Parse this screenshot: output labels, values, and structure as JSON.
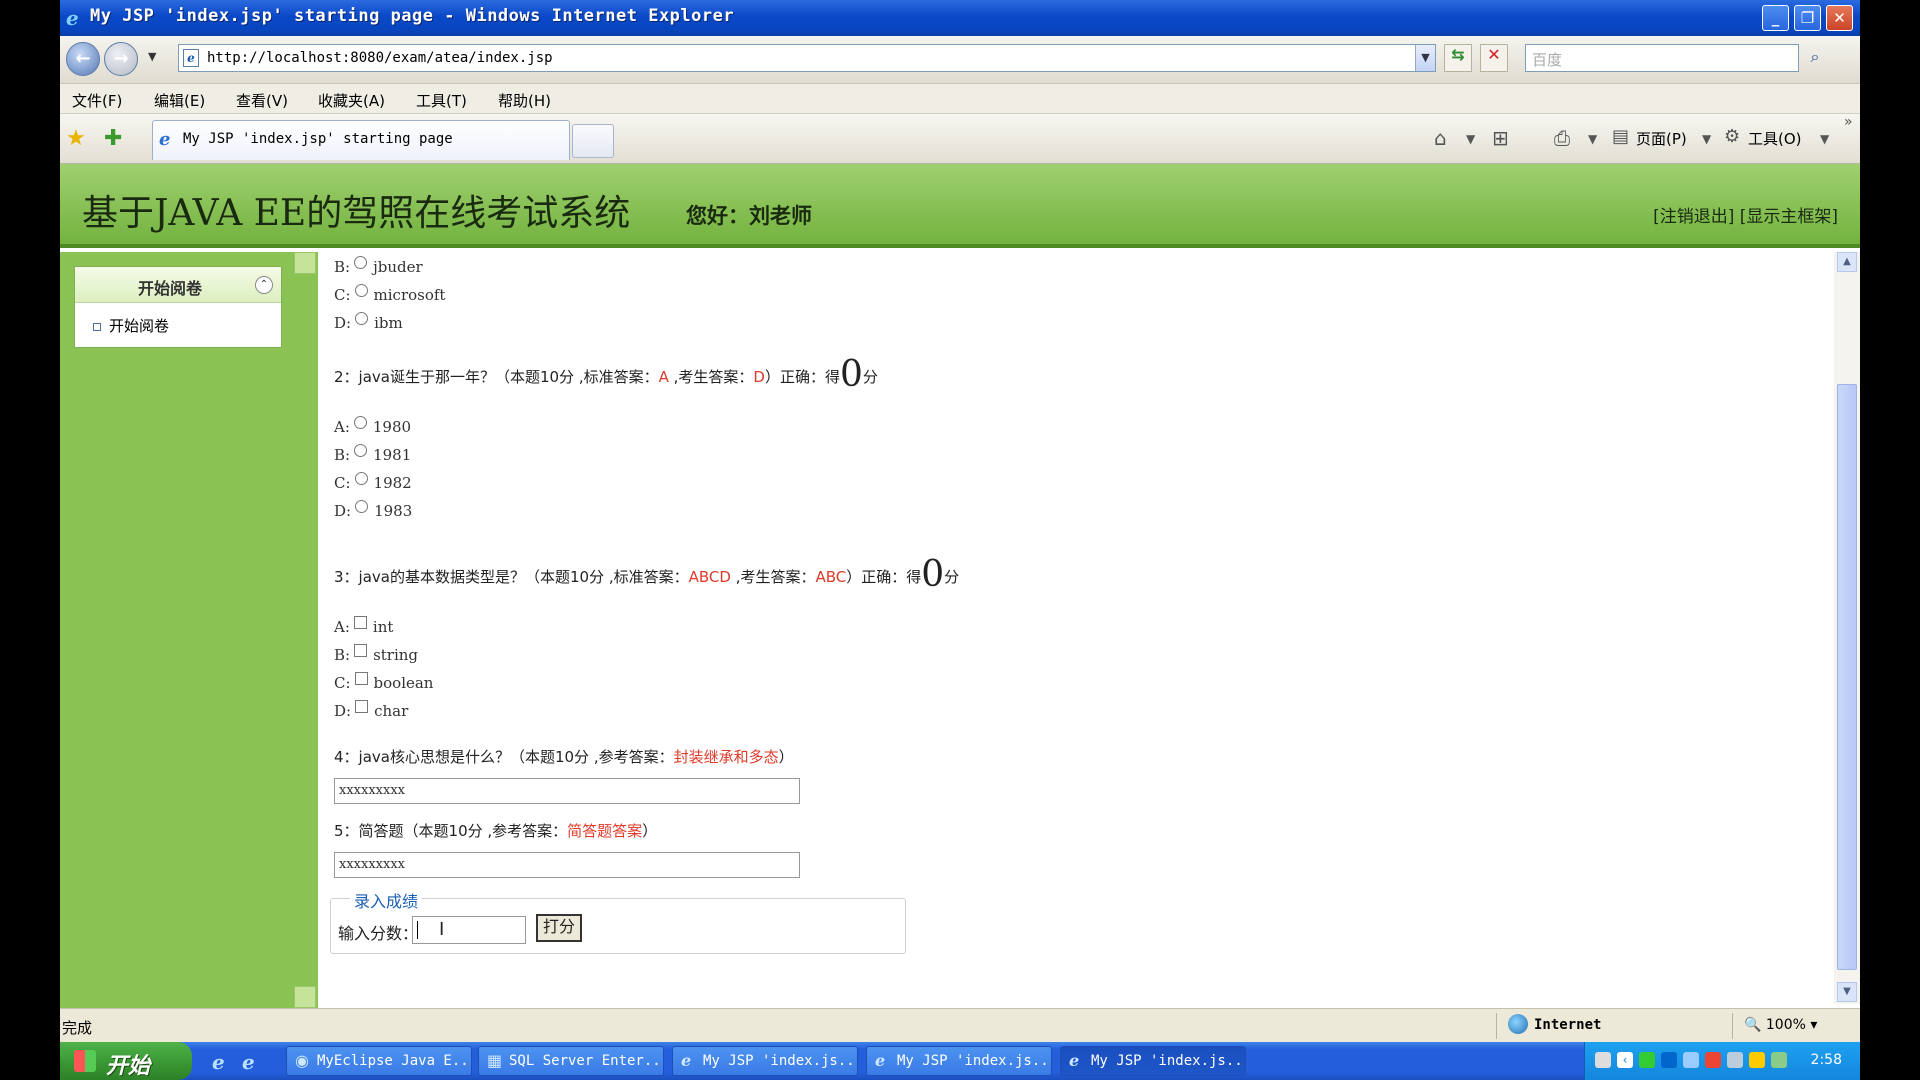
{
  "window": {
    "title": "My JSP 'index.jsp' starting page - Windows Internet Explorer",
    "min": "_",
    "max": "❐",
    "close": "✕"
  },
  "address": {
    "url": "http://localhost:8080/exam/atea/index.jsp",
    "search_placeholder": "百度"
  },
  "menu": [
    "文件(F)",
    "编辑(E)",
    "查看(V)",
    "收藏夹(A)",
    "工具(T)",
    "帮助(H)"
  ],
  "tab": {
    "label": "My JSP 'index.jsp' starting page"
  },
  "commands": {
    "page": "页面(P)",
    "tools": "工具(O)"
  },
  "header": {
    "system_name": "基于JAVA EE的驾照在线考试系统",
    "greeting": "您好：刘老师",
    "logout": "[注销退出]",
    "show_frame": "[显示主框架]"
  },
  "sidebar": {
    "panel_title": "开始阅卷",
    "item": "开始阅卷"
  },
  "q1_tail": [
    {
      "letter": "B:",
      "text": "jbuder"
    },
    {
      "letter": "C:",
      "text": "microsoft"
    },
    {
      "letter": "D:",
      "text": "ibm"
    }
  ],
  "q2": {
    "prefix": "2：java诞生于那一年？（本题10分 ,标准答案：",
    "std": "A",
    "mid": " ,考生答案：",
    "ans": "D",
    "suffix": "）正确：得",
    "score": "0",
    "unit": "分",
    "options": [
      {
        "letter": "A:",
        "text": "1980"
      },
      {
        "letter": "B:",
        "text": "1981"
      },
      {
        "letter": "C:",
        "text": "1982"
      },
      {
        "letter": "D:",
        "text": "1983"
      }
    ]
  },
  "q3": {
    "prefix": "3：java的基本数据类型是？（本题10分 ,标准答案：",
    "std": "ABCD",
    "mid": " ,考生答案：",
    "ans": "ABC",
    "suffix": "）正确：得",
    "score": "0",
    "unit": "分",
    "options": [
      {
        "letter": "A:",
        "text": "int"
      },
      {
        "letter": "B:",
        "text": "string"
      },
      {
        "letter": "C:",
        "text": "boolean"
      },
      {
        "letter": "D:",
        "text": "char"
      }
    ]
  },
  "q4": {
    "prefix": "4：java核心思想是什么？（本题10分 ,参考答案：",
    "ref": "封装继承和多态",
    "suffix": "）",
    "answer": "xxxxxxxxx"
  },
  "q5": {
    "prefix": "5：简答题（本题10分 ,参考答案：",
    "ref": "简答题答案",
    "suffix": "）",
    "answer": "xxxxxxxxx"
  },
  "score_entry": {
    "legend": "录入成绩",
    "label": "输入分数：",
    "button": "打分",
    "value": ""
  },
  "status": {
    "text": "完成",
    "zone": "Internet",
    "zoom": "100%"
  },
  "taskbar": {
    "start": "开始",
    "tasks": [
      "MyEclipse Java E...",
      "SQL Server Enter...",
      "My JSP 'index.js...",
      "My JSP 'index.js...",
      "My JSP 'index.js..."
    ],
    "clock": "2:58"
  },
  "colors": {
    "header_green": "#73b33f",
    "sidebar_green": "#8bc254",
    "answer_red": "#e03a2a",
    "legend_blue": "#1a5fb4"
  }
}
